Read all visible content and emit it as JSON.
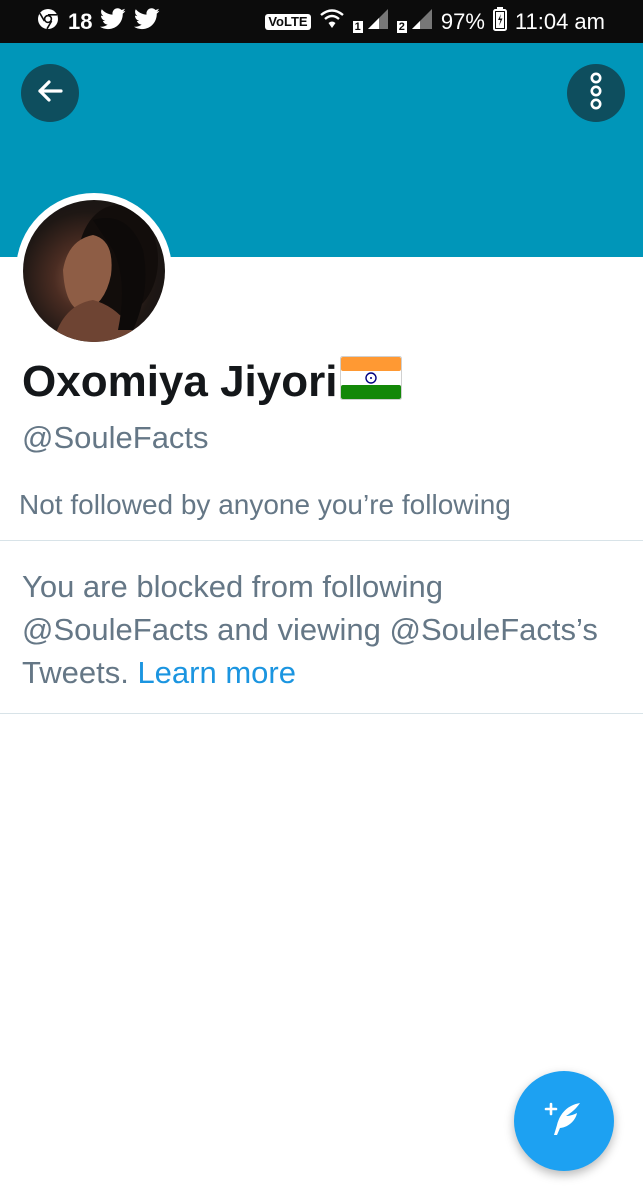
{
  "status_bar": {
    "notification_count": "18",
    "volte_label": "VoLTE",
    "sim1": "1",
    "sim2": "2",
    "battery": "97%",
    "time": "11:04 am",
    "icons": [
      "chrome-icon",
      "twitter-icon",
      "twitter-icon",
      "wifi-icon",
      "signal-icon",
      "battery-icon"
    ]
  },
  "header": {
    "banner_color": "#0096b9",
    "back_icon": "arrow-left-icon",
    "more_icon": "more-vertical-icon"
  },
  "profile": {
    "display_name": "Oxomiya Jiyori",
    "flag_icon": "india-flag-icon",
    "handle": "@SouleFacts",
    "followed_by_text": "Not followed by anyone you’re following",
    "blocked_text": "You are blocked from following @SouleFacts and viewing @SouleFacts’s Tweets.",
    "learn_more": "Learn more"
  },
  "fab": {
    "icon": "compose-tweet-icon",
    "color": "#1da1f2"
  },
  "colors": {
    "primary_text": "#14171a",
    "secondary_text": "#657786",
    "link": "#1b95e0"
  }
}
